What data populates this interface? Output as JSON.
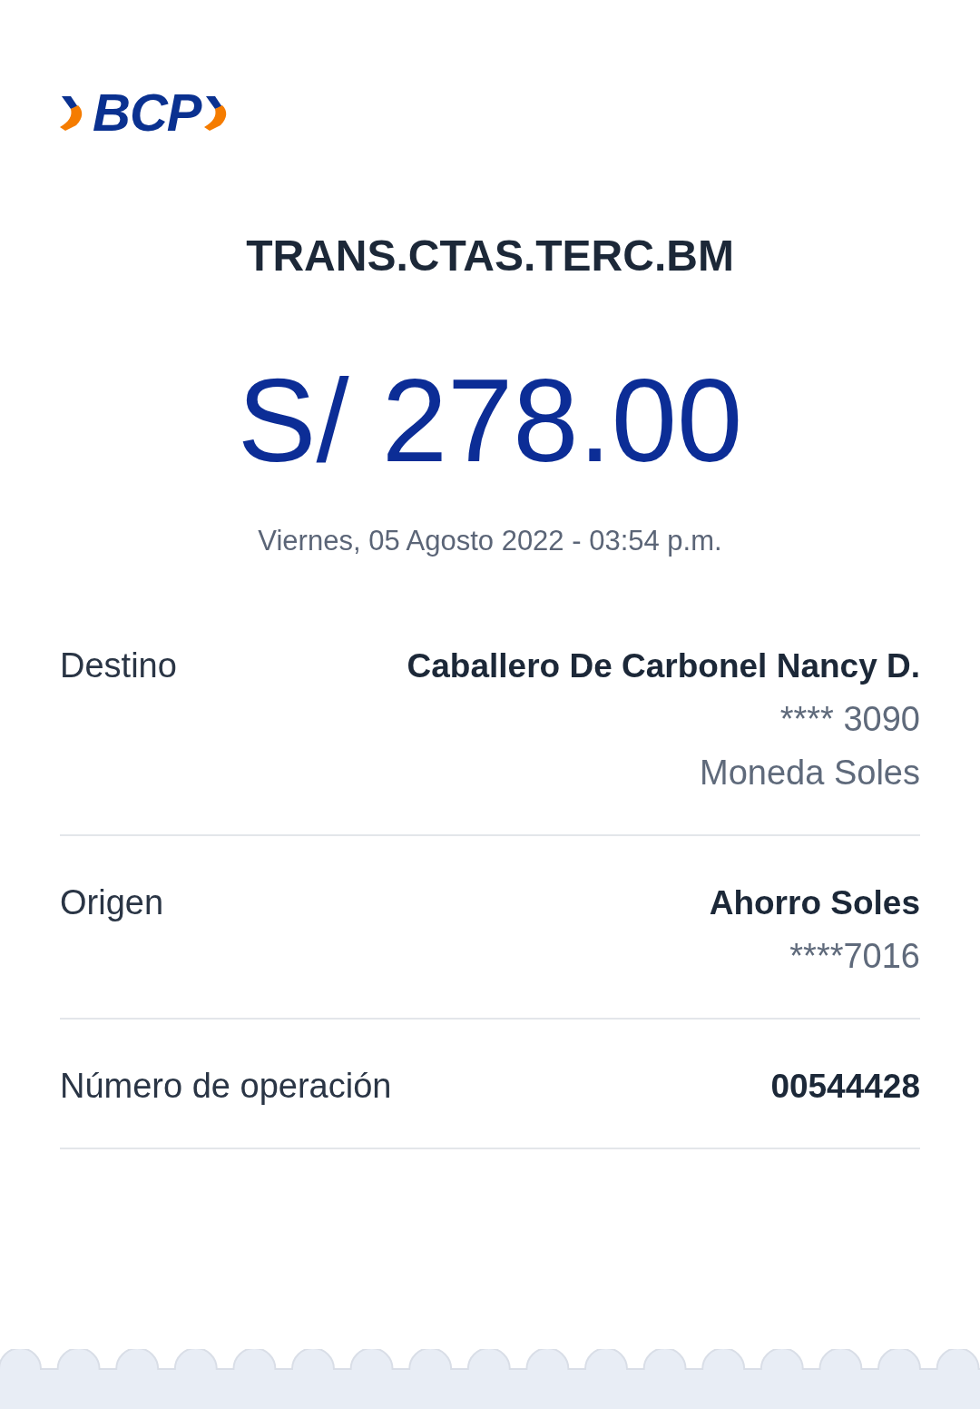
{
  "logo": {
    "text": "BCP"
  },
  "title": "TRANS.CTAS.TERC.BM",
  "amount": "S/ 278.00",
  "datetime": "Viernes, 05 Agosto 2022 - 03:54 p.m.",
  "details": [
    {
      "label": "Destino",
      "lines": [
        {
          "text": "Caballero De Carbonel Nancy D.",
          "kind": "primary"
        },
        {
          "text": "**** 3090",
          "kind": "secondary"
        },
        {
          "text": "Moneda Soles",
          "kind": "secondary"
        }
      ]
    },
    {
      "label": "Origen",
      "lines": [
        {
          "text": "Ahorro Soles",
          "kind": "primary"
        },
        {
          "text": "****7016",
          "kind": "secondary"
        }
      ]
    },
    {
      "label": "Número de operación",
      "lines": [
        {
          "text": "00544428",
          "kind": "primary"
        }
      ]
    }
  ]
}
